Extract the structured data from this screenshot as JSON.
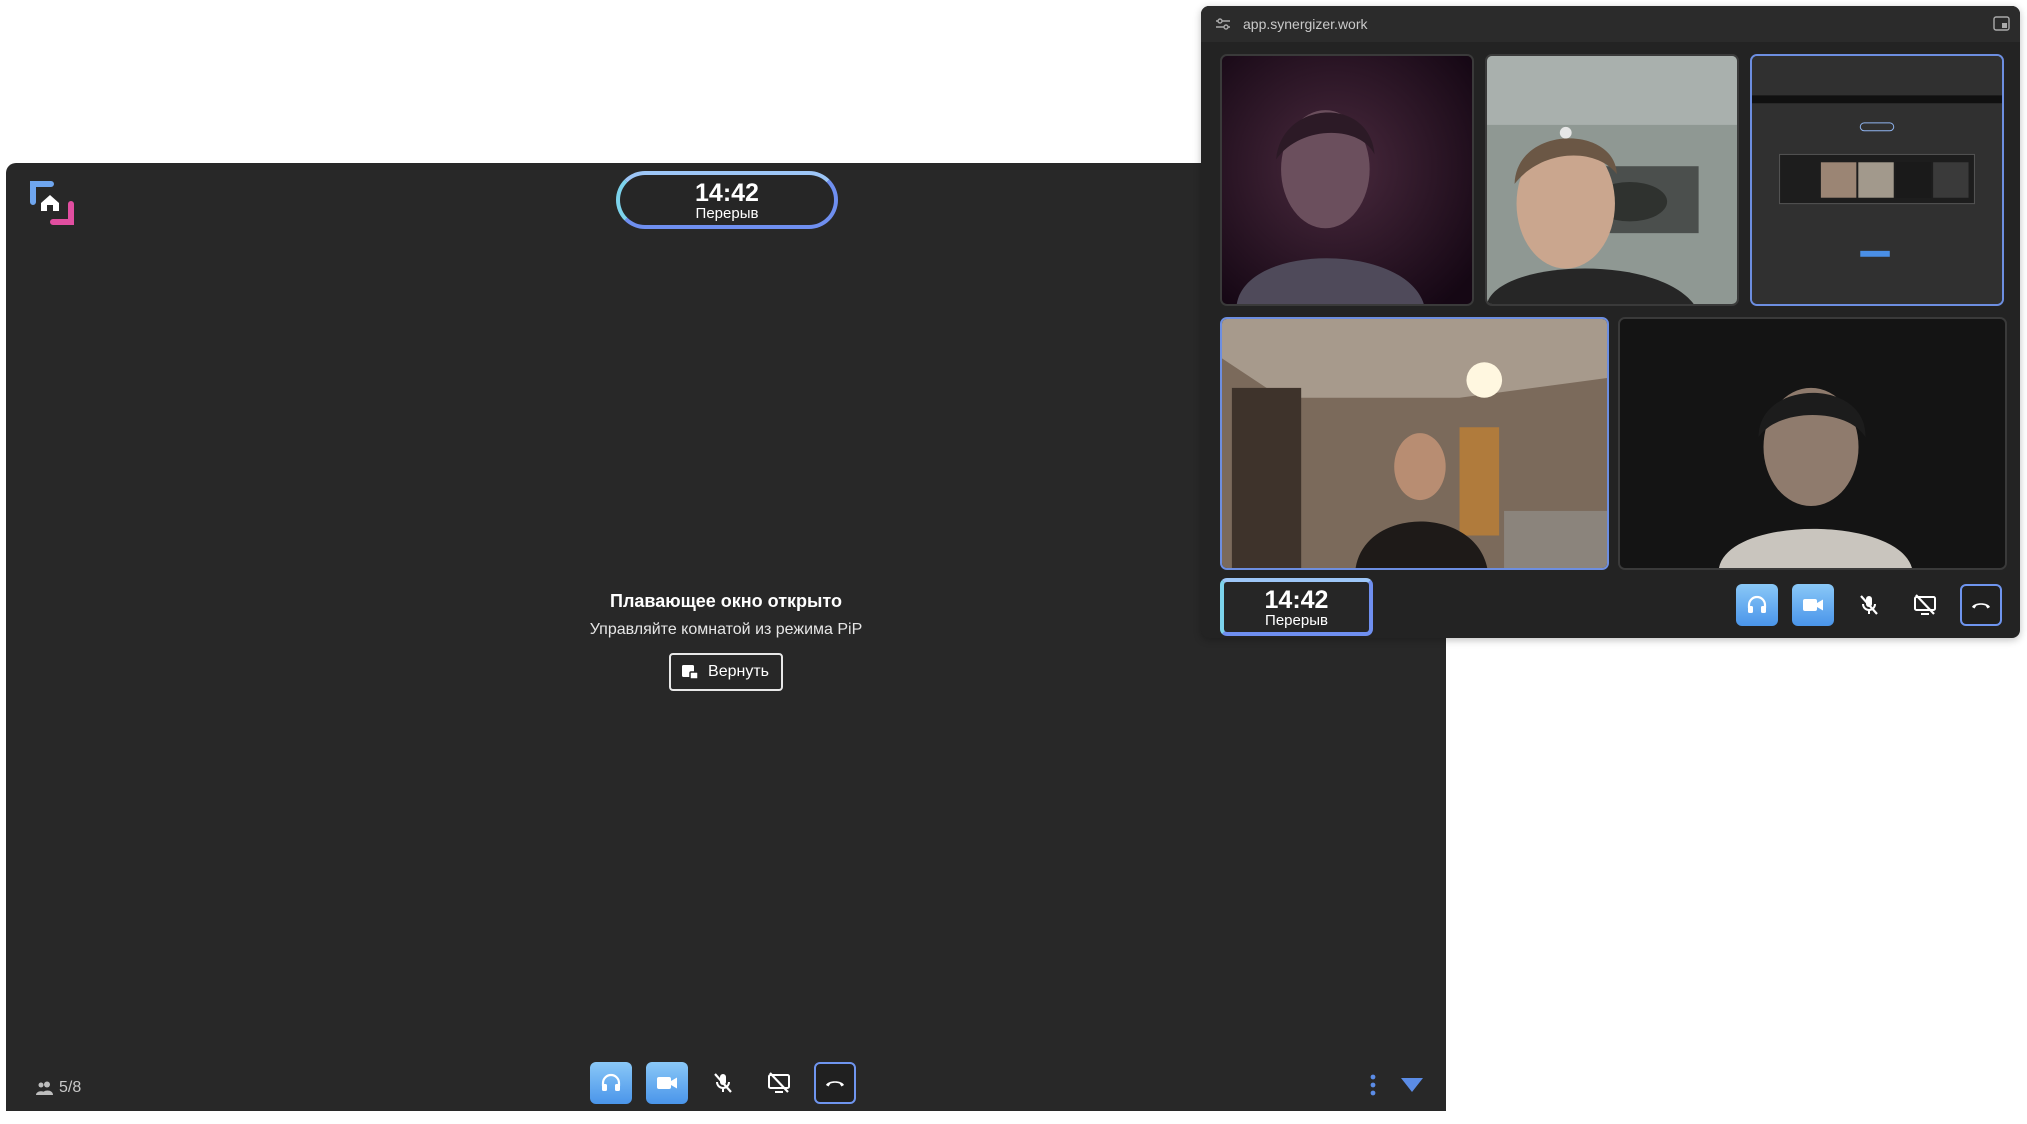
{
  "main": {
    "timer": {
      "time": "14:42",
      "label": "Перерыв"
    },
    "pip_notice": {
      "title": "Плавающее окно открыто",
      "subtitle": "Управляйте комнатой из режима PiP",
      "return_label": "Вернуть"
    },
    "participants": {
      "count": "5/8"
    },
    "controls": [
      "headphones-icon",
      "camera-icon",
      "mic-muted-icon",
      "screen-share-off-icon",
      "hang-up-icon"
    ],
    "more_icon": "more-vertical-icon",
    "collapse_icon": "chevron-down-icon"
  },
  "pip": {
    "url": "app.synergizer.work",
    "timer": {
      "time": "14:42",
      "label": "Перерыв"
    },
    "tiles": [
      {
        "name": "participant-1",
        "active": false
      },
      {
        "name": "participant-2",
        "active": false
      },
      {
        "name": "participant-screen-share",
        "active": true
      },
      {
        "name": "participant-3",
        "active": true
      },
      {
        "name": "participant-4",
        "active": false
      }
    ]
  },
  "colors": {
    "background": "#282828",
    "accent_blue": "#4a95ea",
    "accent_light_blue": "#8ac8f7",
    "border_blue": "#6f95ef",
    "logo_pink": "#e14ea0"
  }
}
